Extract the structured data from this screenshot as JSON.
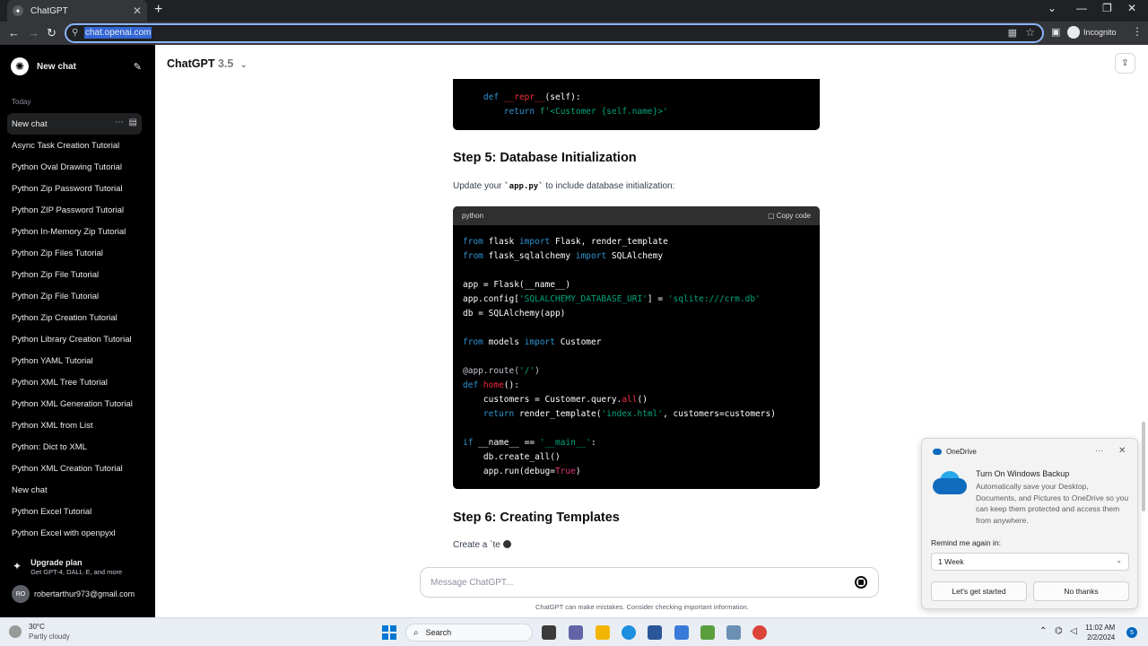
{
  "browser": {
    "tab_title": "ChatGPT",
    "tab_close": "✕",
    "new_tab": "+",
    "url": "chat.openai.com",
    "incognito_label": "Incognito"
  },
  "sidebar": {
    "new_chat_label": "New chat",
    "today_label": "Today",
    "items": [
      {
        "label": "New chat"
      },
      {
        "label": "Async Task Creation Tutorial"
      },
      {
        "label": "Python Oval Drawing Tutorial"
      },
      {
        "label": "Python Zip Password Tutorial"
      },
      {
        "label": "Python ZIP Password Tutorial"
      },
      {
        "label": "Python In-Memory Zip Tutorial"
      },
      {
        "label": "Python Zip Files Tutorial"
      },
      {
        "label": "Python Zip File Tutorial"
      },
      {
        "label": "Python Zip File Tutorial"
      },
      {
        "label": "Python Zip Creation Tutorial"
      },
      {
        "label": "Python Library Creation Tutorial"
      },
      {
        "label": "Python YAML Tutorial"
      },
      {
        "label": "Python XML Tree Tutorial"
      },
      {
        "label": "Python XML Generation Tutorial"
      },
      {
        "label": "Python XML from List"
      },
      {
        "label": "Python: Dict to XML"
      },
      {
        "label": "Python XML Creation Tutorial"
      },
      {
        "label": "New chat"
      },
      {
        "label": "Python Excel Tutorial"
      },
      {
        "label": "Python Excel with openpyxl"
      }
    ],
    "upgrade_title": "Upgrade plan",
    "upgrade_sub": "Get GPT-4, DALL·E, and more",
    "avatar_initials": "RO",
    "user_email": "robertarthur973@gmail.com"
  },
  "header": {
    "model_name": "ChatGPT",
    "model_version": "3.5"
  },
  "content": {
    "code1": {
      "lines": [
        {
          "indent": "    ",
          "kw": "def ",
          "fn": "__repr__",
          "rest": "(self):"
        },
        {
          "indent": "        ",
          "kw": "return ",
          "str": "f'<Customer {self.name}>'"
        }
      ]
    },
    "step5_heading": "Step 5: Database Initialization",
    "step5_para_pre": "Update your ",
    "step5_para_code": "`app.py`",
    "step5_para_post": " to include database initialization:",
    "code2": {
      "language": "python",
      "copy_label": "Copy code"
    },
    "step6_heading": "Step 6: Creating Templates",
    "step6_para": "Create a `te"
  },
  "composer": {
    "placeholder": "Message ChatGPT...",
    "disclaimer": "ChatGPT can make mistakes. Consider checking important information."
  },
  "toast": {
    "app": "OneDrive",
    "title": "Turn On Windows Backup",
    "body": "Automatically save your Desktop, Documents, and Pictures to OneDrive so you can keep them protected and access them from anywhere.",
    "remind_label": "Remind me again in:",
    "remind_value": "1 Week",
    "primary": "Let's get started",
    "secondary": "No thanks"
  },
  "taskbar": {
    "temp": "30°C",
    "condition": "Partly cloudy",
    "search_label": "Search",
    "time": "11:02 AM",
    "date": "2/2/2024",
    "notifications": "5"
  },
  "colors": {
    "sidebar_bg": "#000000",
    "code_keyword": "#2e95d3",
    "code_string": "#00a67d",
    "code_function": "#f22c3d",
    "code_bool": "#df3079"
  }
}
